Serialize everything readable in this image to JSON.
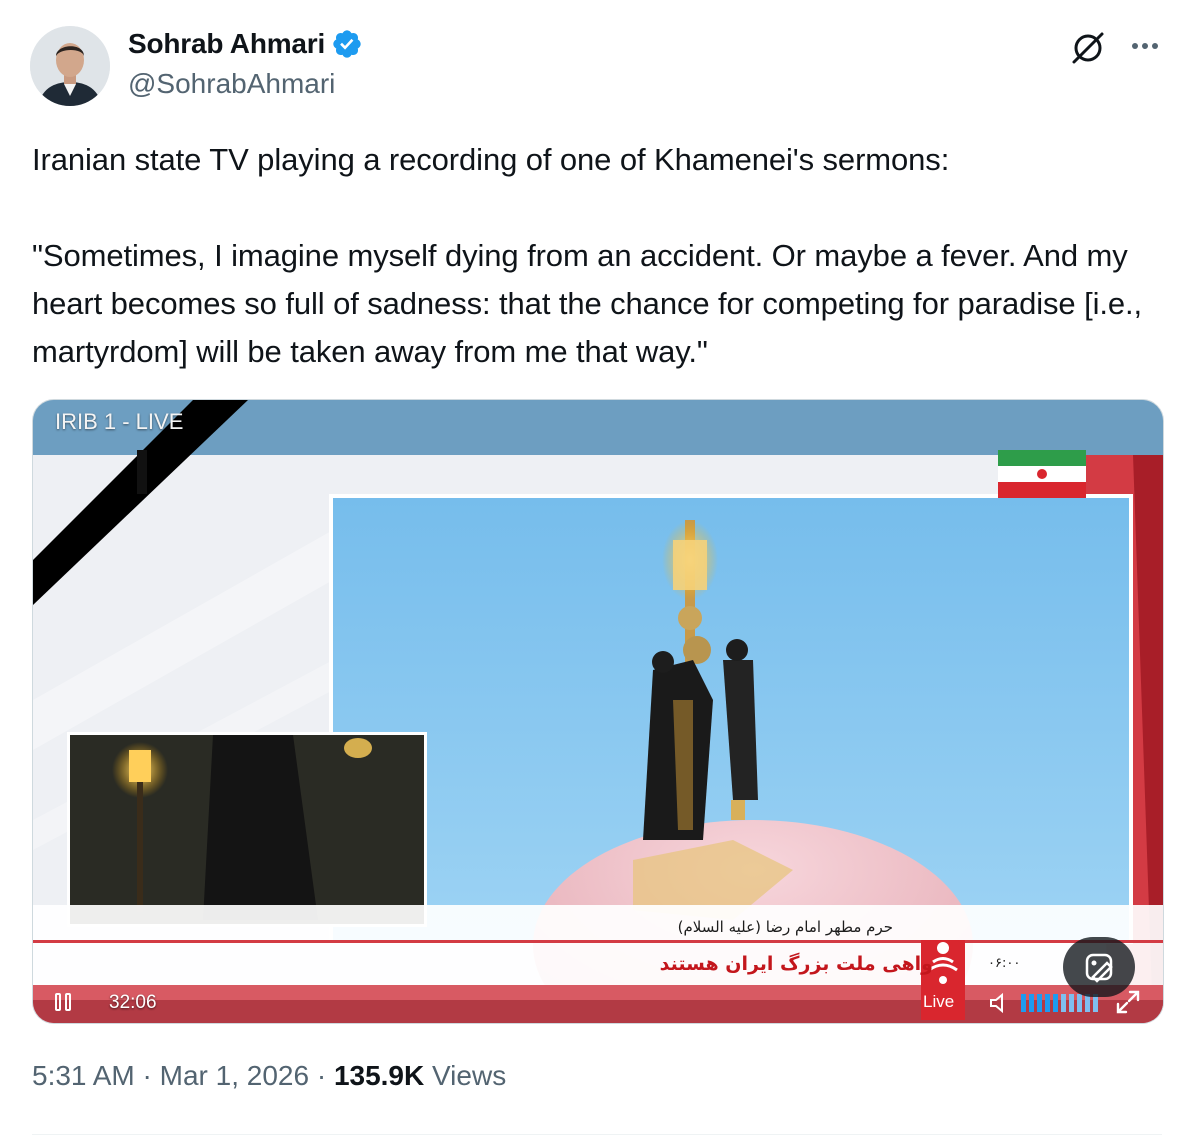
{
  "author": {
    "name": "Sohrab Ahmari",
    "handle": "@SohrabAhmari",
    "verified": true,
    "avatar_icon": "person-avatar-icon"
  },
  "tweet": {
    "text": "Iranian state TV playing a recording of one of Khamenei's sermons:\n\n\"Sometimes, I imagine myself dying from an accident. Or maybe a fever. And my heart becomes so full of sadness: that the chance for competing for paradise [i.e., martyrdom] will be taken away from me that way.\""
  },
  "media": {
    "channel_label": "IRIB 1 - LIVE",
    "caption_small": "حرم مطهر امام رضا (علیه السلام)",
    "caption_big": "واهی ملت بزرگ ایران هستند",
    "ticker_time": "۰۶:۰۰",
    "time_display": "32:06",
    "live_label": "Live",
    "accent_color": "#c3161c",
    "sky_color": "#8cc8ef"
  },
  "meta": {
    "time": "5:31 AM",
    "separator": " · ",
    "date": "Mar 1, 2026",
    "views_count": "135.9K",
    "views_label": " Views"
  }
}
